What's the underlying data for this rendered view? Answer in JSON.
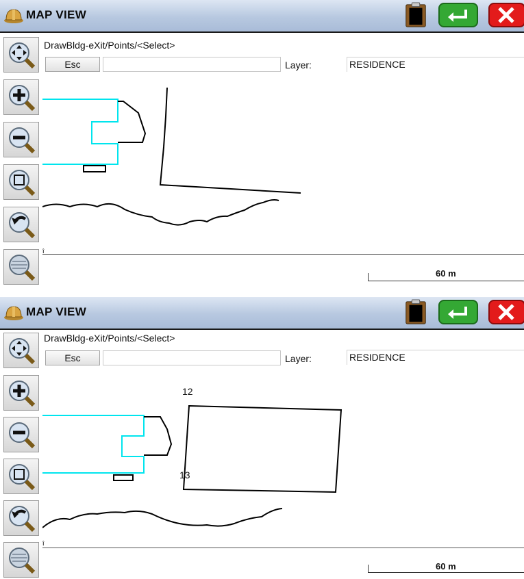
{
  "panels": [
    {
      "title": "MAP VIEW",
      "command": "DrawBldg-eXit/Points/<Select>",
      "esc_label": "Esc",
      "layer_label": "Layer:",
      "layer_value": "RESIDENCE",
      "scale_label": "60 m",
      "point_labels": []
    },
    {
      "title": "MAP VIEW",
      "command": "DrawBldg-eXit/Points/<Select>",
      "esc_label": "Esc",
      "layer_label": "Layer:",
      "layer_value": "RESIDENCE",
      "scale_label": "60 m",
      "point_labels": [
        "12",
        "13"
      ]
    }
  ],
  "icons": {
    "titlebar": [
      "hardhat-icon",
      "clipboard-icon",
      "enter-icon",
      "close-icon"
    ],
    "tools": [
      "pan-icon",
      "zoom-in-icon",
      "zoom-out-icon",
      "zoom-window-icon",
      "zoom-previous-icon",
      "zoom-extents-icon"
    ]
  },
  "colors": {
    "titlebar": "#b7c8e0",
    "accept": "#2e9b2e",
    "cancel": "#e01818",
    "existing_linework": "#00e5ee",
    "linework": "#000000"
  }
}
